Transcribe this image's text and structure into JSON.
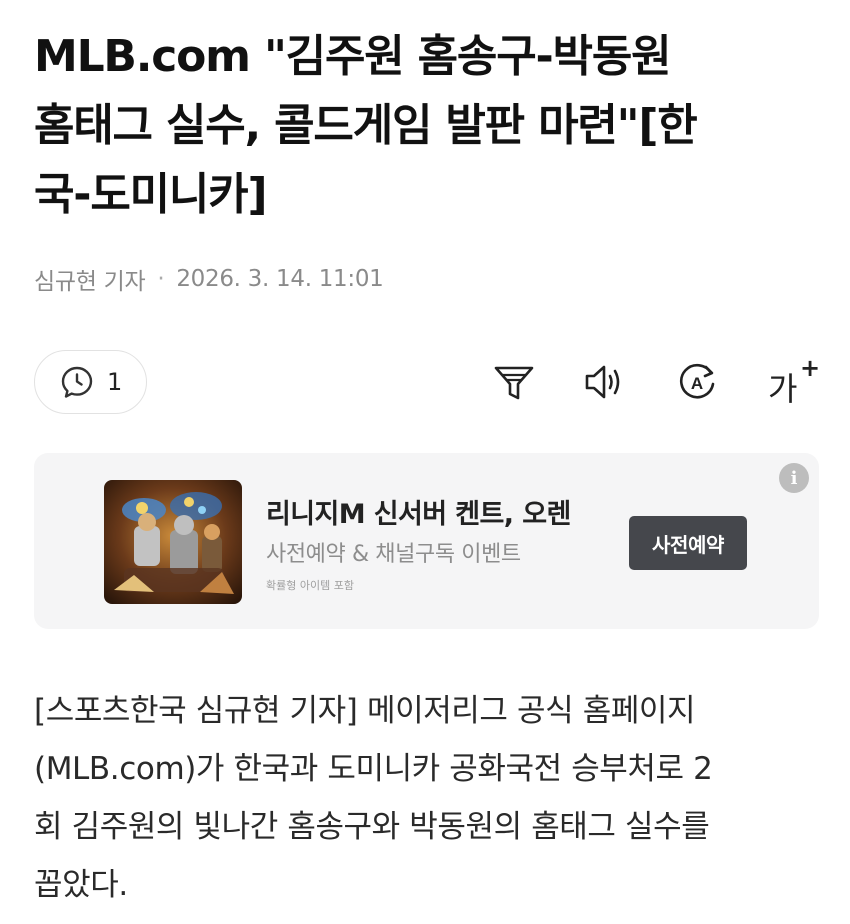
{
  "article": {
    "headline_lines": [
      "MLB.com \"김주원 홈송구-박동원",
      "홈태그 실수, 콜드게임 발판 마련\"[한",
      "국-도미니카]"
    ],
    "reporter": "심규현 기자",
    "separator": "·",
    "date": "2026. 3. 14. 11:01",
    "body_lines": [
      "[스포츠한국 심규현 기자] 메이저리그 공식 홈페이지",
      "(MLB.com)가 한국과 도미니카 공화국전 승부처로 2",
      "회 김주원의 빛나간 홈송구와 박동원의 홈태그 실수를",
      "꼽았다."
    ]
  },
  "toolbar": {
    "comment_count": "1",
    "icons": [
      "comment-clock-icon",
      "filter-icon",
      "speaker-icon",
      "translate-icon",
      "font-size-icon"
    ],
    "font_icon_text": "가",
    "font_icon_plus": "+",
    "translate_letter": "A"
  },
  "ad": {
    "title": "리니지M 신서버 켄트, 오렌",
    "subtitle": "사전예약 & 채널구독 이벤트",
    "note": "확률형 아이템 포함",
    "button": "사전예약",
    "info_icon": "i"
  }
}
